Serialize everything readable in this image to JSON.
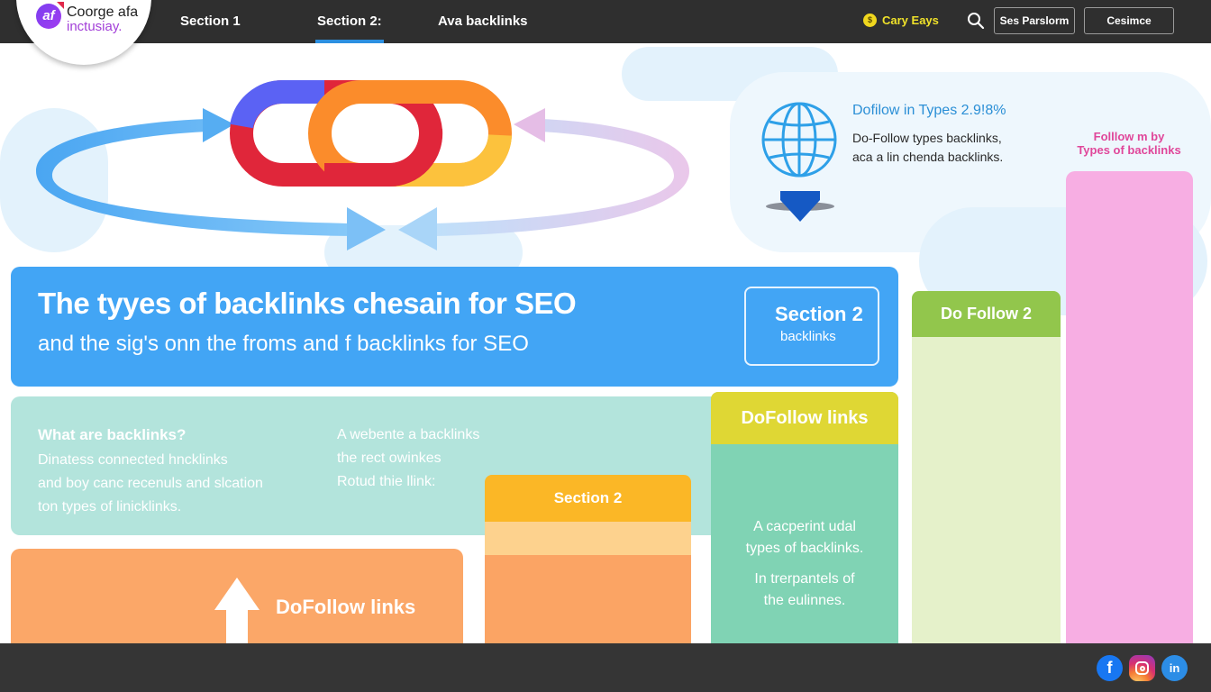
{
  "brand": {
    "name_line1": "Coorge afa",
    "name_line2": "inctusiay.",
    "mark": "af",
    "colors": {
      "purple": "#8a3ef0",
      "accent": "#2c8fe0",
      "navbar": "#2f2f2f"
    }
  },
  "nav": {
    "tabs": [
      {
        "label": "Section 1",
        "active": false
      },
      {
        "label": "Section 2:",
        "active": true
      },
      {
        "label": "Ava backlinks",
        "active": false
      }
    ],
    "user": {
      "icon": "coin-icon",
      "label": "Cary Eays"
    },
    "search_icon": "search-icon",
    "buttons": [
      {
        "label": "Ses Parslorm"
      },
      {
        "label": "Cesimce"
      }
    ]
  },
  "hero": {
    "icon": "chain-link-icon",
    "arrows": "circular-arrows-icon"
  },
  "info": {
    "icon": "globe-icon",
    "title": "Dofilow in Types 2.9!8%",
    "lines": [
      "Do-Follow types backlinks,",
      "aca a lin chenda backlinks."
    ],
    "pink_label": [
      "Folllow m by",
      "Types of backlinks"
    ]
  },
  "banner": {
    "title": "The tyyes of backlinks chesain for SEO",
    "subtitle": "and the sig's onn the froms and f backlinks for SEO",
    "box_title": "Section 2",
    "box_subtitle": "backlinks",
    "color": "#42a5f5"
  },
  "teal_card": {
    "heading": "What are backlinks?",
    "lines": [
      "Dinatess connected hncklinks",
      "and boy canc recenuls and slcation",
      "ton types of linicklinks."
    ],
    "right_lines": [
      "A webente a backlinks",
      "the rect owinkes",
      "Rotud thie llink:"
    ]
  },
  "orange_tab": {
    "label": "Section 2"
  },
  "orange_card": {
    "label": "DoFollow links",
    "icon": "up-arrow-icon"
  },
  "green_col": {
    "header": "DoFollow links",
    "lines_a": [
      "A cacperint udal",
      "types of backlinks."
    ],
    "lines_b": [
      "In trerpantels of",
      "the eulinnes."
    ]
  },
  "lightgreen_col": {
    "header": "Do Follow 2"
  },
  "footer": {
    "social": [
      {
        "name": "facebook",
        "glyph": "f"
      },
      {
        "name": "instagram",
        "glyph": ""
      },
      {
        "name": "linkedin",
        "glyph": "in"
      }
    ]
  }
}
